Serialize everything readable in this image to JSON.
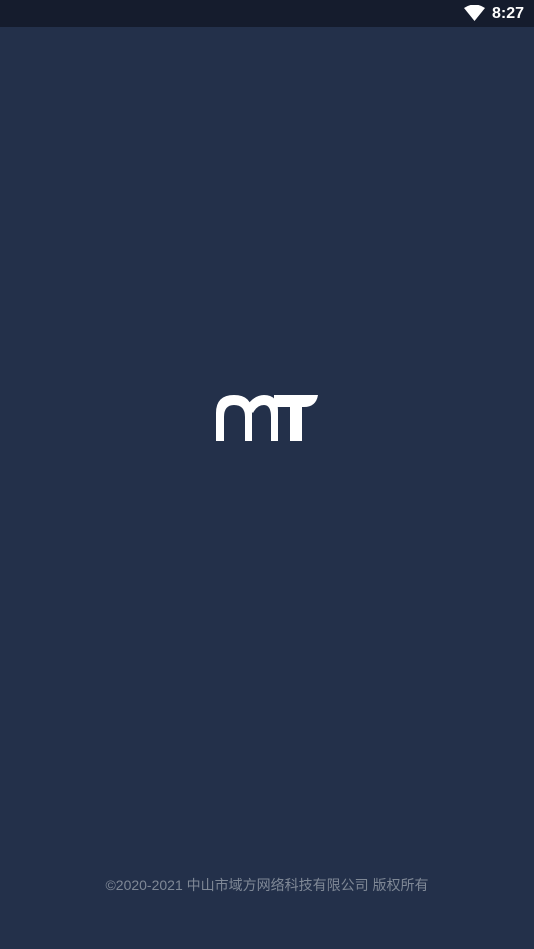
{
  "status_bar": {
    "time": "8:27",
    "icons": [
      "wifi-icon"
    ]
  },
  "splash": {
    "logo": "app-logo",
    "copyright": "©2020-2021 中山市域方网络科技有限公司 版权所有"
  },
  "colors": {
    "background": "#23304a",
    "status_bar": "#151c2d",
    "logo": "#ffffff",
    "copyright_text": "#7f8896"
  }
}
